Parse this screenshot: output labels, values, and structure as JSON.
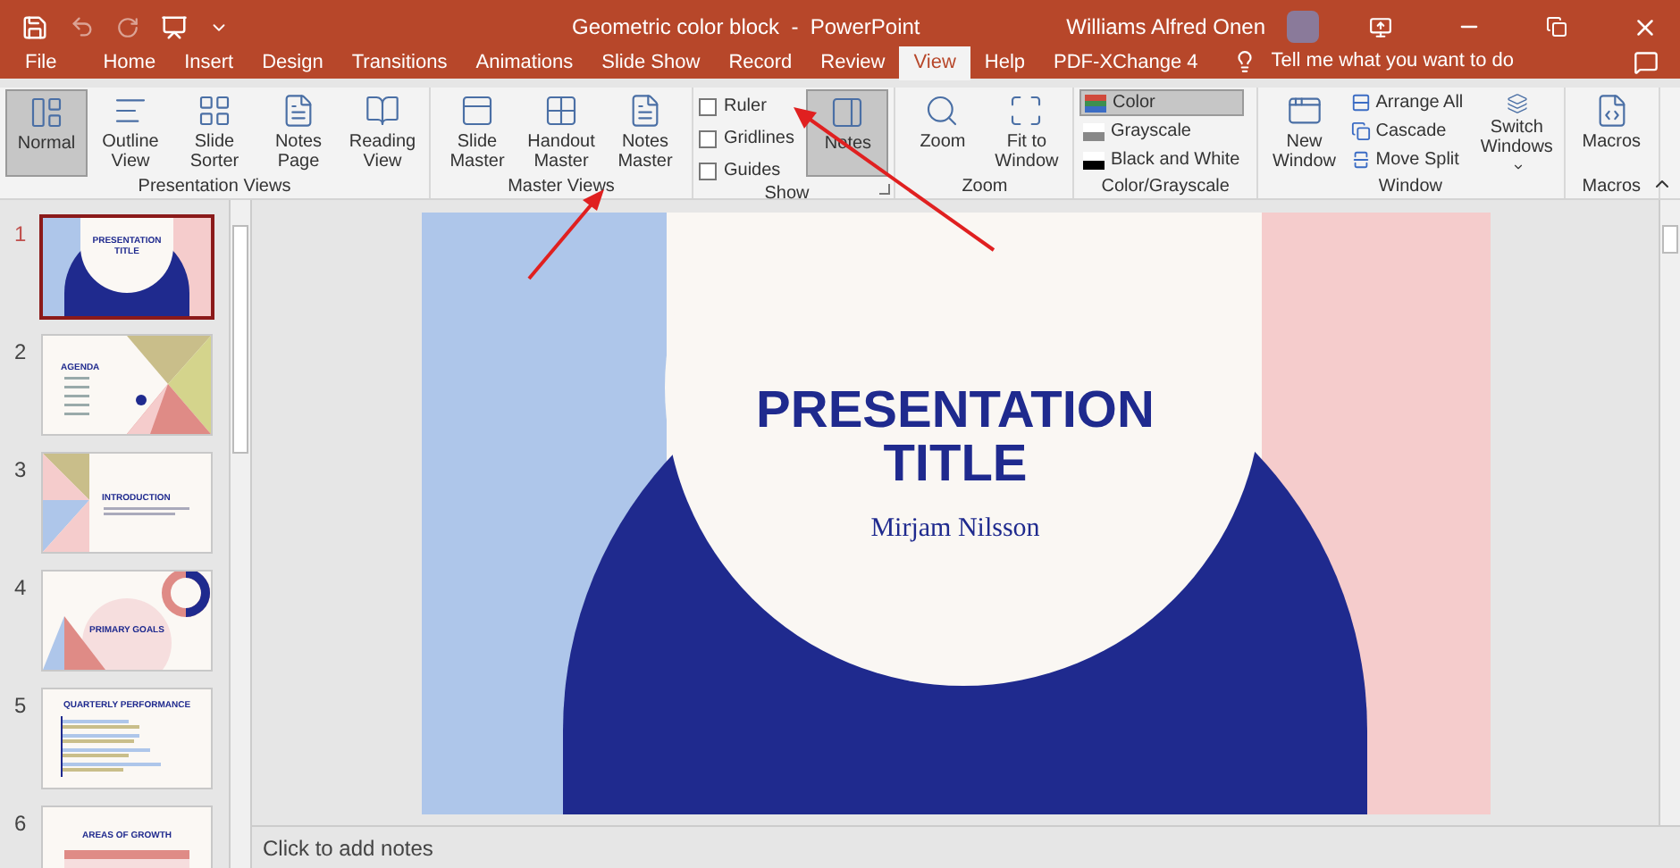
{
  "window": {
    "title": "Geometric color block  -  PowerPoint",
    "user": "Williams Alfred Onen"
  },
  "tabs": [
    {
      "label": "File",
      "selected": false
    },
    {
      "label": "Home",
      "selected": false
    },
    {
      "label": "Insert",
      "selected": false
    },
    {
      "label": "Design",
      "selected": false
    },
    {
      "label": "Transitions",
      "selected": false
    },
    {
      "label": "Animations",
      "selected": false
    },
    {
      "label": "Slide Show",
      "selected": false
    },
    {
      "label": "Record",
      "selected": false
    },
    {
      "label": "Review",
      "selected": false
    },
    {
      "label": "View",
      "selected": true
    },
    {
      "label": "Help",
      "selected": false
    },
    {
      "label": "PDF-XChange 4",
      "selected": false
    }
  ],
  "tell_me": {
    "placeholder": "Tell me what you want to do"
  },
  "ribbon": [
    {
      "label": "Presentation Views",
      "items": [
        {
          "kind": "big",
          "label": "Normal",
          "selected": true
        },
        {
          "kind": "big",
          "label": "Outline View",
          "selected": false
        },
        {
          "kind": "big",
          "label": "Slide Sorter",
          "selected": false
        },
        {
          "kind": "big",
          "label": "Notes Page",
          "selected": false
        },
        {
          "kind": "big",
          "label": "Reading View",
          "selected": false
        }
      ]
    },
    {
      "label": "Master Views",
      "items": [
        {
          "kind": "big",
          "label": "Slide Master",
          "selected": false
        },
        {
          "kind": "big",
          "label": "Handout Master",
          "selected": false
        },
        {
          "kind": "big",
          "label": "Notes Master",
          "selected": false
        }
      ]
    },
    {
      "label": "Show",
      "launcher": true,
      "items": [
        {
          "kind": "checks",
          "rows": [
            {
              "label": "Ruler",
              "checked": false
            },
            {
              "label": "Gridlines",
              "checked": false
            },
            {
              "label": "Guides",
              "checked": false
            }
          ]
        },
        {
          "kind": "big",
          "label": "Notes",
          "selected": true
        }
      ]
    },
    {
      "label": "Zoom",
      "items": [
        {
          "kind": "big",
          "label": "Zoom",
          "selected": false
        },
        {
          "kind": "big",
          "label": "Fit to Window",
          "selected": false
        }
      ]
    },
    {
      "label": "Color/Grayscale",
      "items": [
        {
          "kind": "small",
          "rows": [
            {
              "label": "Color",
              "selected": true
            },
            {
              "label": "Grayscale",
              "selected": false
            },
            {
              "label": "Black and White",
              "selected": false
            }
          ]
        }
      ]
    },
    {
      "label": "Window",
      "items": [
        {
          "kind": "big",
          "label": "New Window",
          "selected": false
        },
        {
          "kind": "small",
          "rows": [
            {
              "label": "Arrange All",
              "selected": false
            },
            {
              "label": "Cascade",
              "selected": false
            },
            {
              "label": "Move Split",
              "selected": false
            }
          ]
        },
        {
          "kind": "big",
          "label": "Switch Windows",
          "dropdown": true,
          "selected": false
        }
      ]
    },
    {
      "label": "Macros",
      "items": [
        {
          "kind": "big",
          "label": "Macros",
          "selected": false
        }
      ]
    }
  ],
  "slides": [
    {
      "number": "1",
      "title": "PRESENTATION TITLE",
      "selected": true
    },
    {
      "number": "2",
      "title": "AGENDA",
      "selected": false
    },
    {
      "number": "3",
      "title": "INTRODUCTION",
      "selected": false
    },
    {
      "number": "4",
      "title": "PRIMARY GOALS",
      "selected": false
    },
    {
      "number": "5",
      "title": "QUARTERLY PERFORMANCE",
      "selected": false
    },
    {
      "number": "6",
      "title": "AREAS OF GROWTH",
      "selected": false
    }
  ],
  "slide": {
    "title": "PRESENTATION TITLE",
    "subtitle": "Mirjam Nilsson"
  },
  "notes": {
    "placeholder": "Click to add notes"
  }
}
